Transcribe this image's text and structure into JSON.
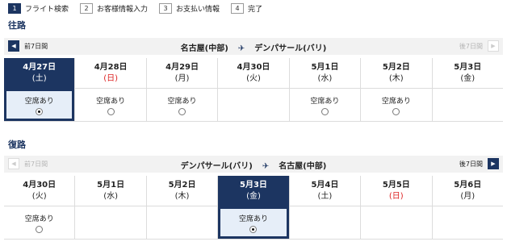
{
  "steps": [
    {
      "num": "1",
      "label": "フライト検索",
      "active": true
    },
    {
      "num": "2",
      "label": "お客様情報入力",
      "active": false
    },
    {
      "num": "3",
      "label": "お支払い情報",
      "active": false
    },
    {
      "num": "4",
      "label": "完了",
      "active": false
    }
  ],
  "outbound": {
    "title": "往路",
    "prev_label": "前7日間",
    "next_label": "後7日間",
    "prev_enabled": true,
    "next_enabled": false,
    "from": "名古屋(中部)",
    "to": "デンパサール(バリ)",
    "days": [
      {
        "date": "4月27日",
        "dow": "(土)",
        "holiday": false,
        "seat": "空席あり",
        "available": true,
        "selected": true
      },
      {
        "date": "4月28日",
        "dow": "(日)",
        "holiday": true,
        "seat": "空席あり",
        "available": true,
        "selected": false
      },
      {
        "date": "4月29日",
        "dow": "(月)",
        "holiday": false,
        "seat": "空席あり",
        "available": true,
        "selected": false
      },
      {
        "date": "4月30日",
        "dow": "(火)",
        "holiday": false,
        "seat": "",
        "available": false,
        "selected": false
      },
      {
        "date": "5月1日",
        "dow": "(水)",
        "holiday": false,
        "seat": "空席あり",
        "available": true,
        "selected": false
      },
      {
        "date": "5月2日",
        "dow": "(木)",
        "holiday": false,
        "seat": "空席あり",
        "available": true,
        "selected": false
      },
      {
        "date": "5月3日",
        "dow": "(金)",
        "holiday": false,
        "seat": "",
        "available": false,
        "selected": false
      }
    ]
  },
  "inbound": {
    "title": "復路",
    "prev_label": "前7日間",
    "next_label": "後7日間",
    "prev_enabled": false,
    "next_enabled": true,
    "from": "デンパサール(バリ)",
    "to": "名古屋(中部)",
    "days": [
      {
        "date": "4月30日",
        "dow": "(火)",
        "holiday": false,
        "seat": "空席あり",
        "available": true,
        "selected": false
      },
      {
        "date": "5月1日",
        "dow": "(水)",
        "holiday": false,
        "seat": "",
        "available": false,
        "selected": false
      },
      {
        "date": "5月2日",
        "dow": "(木)",
        "holiday": false,
        "seat": "",
        "available": false,
        "selected": false
      },
      {
        "date": "5月3日",
        "dow": "(金)",
        "holiday": false,
        "seat": "空席あり",
        "available": true,
        "selected": true
      },
      {
        "date": "5月4日",
        "dow": "(土)",
        "holiday": false,
        "seat": "",
        "available": false,
        "selected": false
      },
      {
        "date": "5月5日",
        "dow": "(日)",
        "holiday": true,
        "seat": "",
        "available": false,
        "selected": false
      },
      {
        "date": "5月6日",
        "dow": "(月)",
        "holiday": false,
        "seat": "",
        "available": false,
        "selected": false
      }
    ]
  },
  "icons": {
    "prev": "chevron-left-icon",
    "next": "chevron-right-icon",
    "plane": "airplane-icon"
  },
  "colors": {
    "brand": "#1c3561",
    "holiday": "#dd2222",
    "selected_cell": "#e6eef8"
  }
}
